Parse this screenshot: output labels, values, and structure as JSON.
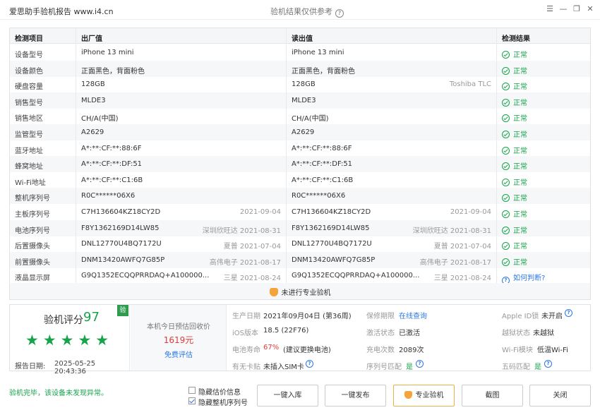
{
  "app_title": "爱思助手验机报告 www.i4.cn",
  "center_title": "验机结果仅供参考",
  "window_icons": [
    "menu-icon",
    "minimize-icon",
    "restore-icon",
    "close-icon"
  ],
  "table": {
    "headers": [
      "检测项目",
      "出厂值",
      "读出值",
      "检测结果"
    ],
    "rows": [
      {
        "name": "设备型号",
        "factory": "iPhone 13 mini",
        "factory_date": "",
        "read": "iPhone 13 mini",
        "read_date": "",
        "result": "正常",
        "status": "ok"
      },
      {
        "name": "设备颜色",
        "factory": "正面黑色，背面粉色",
        "factory_date": "",
        "read": "正面黑色，背面粉色",
        "read_date": "",
        "result": "正常",
        "status": "ok"
      },
      {
        "name": "硬盘容量",
        "factory": "128GB",
        "factory_date": "",
        "read": "128GB",
        "read_date": "Toshiba TLC",
        "result": "正常",
        "status": "ok"
      },
      {
        "name": "销售型号",
        "factory": "MLDE3",
        "factory_date": "",
        "read": "MLDE3",
        "read_date": "",
        "result": "正常",
        "status": "ok"
      },
      {
        "name": "销售地区",
        "factory": "CH/A(中国)",
        "factory_date": "",
        "read": "CH/A(中国)",
        "read_date": "",
        "result": "正常",
        "status": "ok"
      },
      {
        "name": "监管型号",
        "factory": "A2629",
        "factory_date": "",
        "read": "A2629",
        "read_date": "",
        "result": "正常",
        "status": "ok"
      },
      {
        "name": "蓝牙地址",
        "factory": "A*:**:CF:**:88:6F",
        "factory_date": "",
        "read": "A*:**:CF:**:88:6F",
        "read_date": "",
        "result": "正常",
        "status": "ok"
      },
      {
        "name": "蜂窝地址",
        "factory": "A*:**:CF:**:DF:51",
        "factory_date": "",
        "read": "A*:**:CF:**:DF:51",
        "read_date": "",
        "result": "正常",
        "status": "ok"
      },
      {
        "name": "Wi-Fi地址",
        "factory": "A*:**:CF:**:C1:6B",
        "factory_date": "",
        "read": "A*:**:CF:**:C1:6B",
        "read_date": "",
        "result": "正常",
        "status": "ok"
      },
      {
        "name": "整机序列号",
        "factory": "R0C******06X6",
        "factory_date": "",
        "read": "R0C******06X6",
        "read_date": "",
        "result": "正常",
        "status": "ok"
      },
      {
        "name": "主板序列号",
        "factory": "C7H136604KZ18CY2D",
        "factory_date": "2021-09-04",
        "read": "C7H136604KZ18CY2D",
        "read_date": "2021-09-04",
        "result": "正常",
        "status": "ok"
      },
      {
        "name": "电池序列号",
        "factory": "F8Y1362169D14LW85",
        "factory_date": "深圳欣旺达 2021-08-31",
        "read": "F8Y1362169D14LW85",
        "read_date": "深圳欣旺达 2021-08-31",
        "result": "正常",
        "status": "ok"
      },
      {
        "name": "后置摄像头",
        "factory": "DNL12770U4BQ7172U",
        "factory_date": "夏普 2021-07-04",
        "read": "DNL12770U4BQ7172U",
        "read_date": "夏普 2021-07-04",
        "result": "正常",
        "status": "ok"
      },
      {
        "name": "前置摄像头",
        "factory": "DNM13420AWFQ7G85P",
        "factory_date": "高伟电子 2021-08-17",
        "read": "DNM13420AWFQ7G85P",
        "read_date": "高伟电子 2021-08-17",
        "result": "正常",
        "status": "ok"
      },
      {
        "name": "液晶显示屏",
        "factory": "G9Q1352ECQQPRRDAQ+A100000...",
        "factory_date": "三星 2021-08-24",
        "read": "G9Q1352ECQQPRRDAQ+A100000...",
        "read_date": "三星 2021-08-24",
        "result": "如何判断?",
        "status": "question"
      }
    ],
    "footer_note": "未进行专业验机"
  },
  "summary": {
    "score_label": "验机评分",
    "score": "97",
    "badge": "验",
    "stars": "★★★★★",
    "report_date_label": "报告日期:",
    "report_date": "2025-05-25 20:43:36",
    "price_label": "本机今日预估回收价",
    "price": "1619元",
    "price_link": "免费评估",
    "info": [
      {
        "k": "生产日期",
        "v": "2021年09月04日 (第36周)"
      },
      {
        "k": "保修期限",
        "v": "在线查询"
      },
      {
        "k": "Apple ID锁",
        "v": "未开启"
      },
      {
        "k": "iOS版本",
        "v": "18.5 (22F76)"
      },
      {
        "k": "激活状态",
        "v": "已激活"
      },
      {
        "k": "越狱状态",
        "v": "未越狱"
      },
      {
        "k": "电池寿命",
        "v": "67%",
        "v2": "(建议更换电池)"
      },
      {
        "k": "充电次数",
        "v": "2089次"
      },
      {
        "k": "Wi-Fi模块",
        "v": "低温Wi-Fi"
      },
      {
        "k": "有无卡贴",
        "v": "未插入SIM卡"
      },
      {
        "k": "序列号匹配",
        "v": "是"
      },
      {
        "k": "五码匹配",
        "v": "是"
      }
    ]
  },
  "bottom": {
    "status_msg": "验机完毕，该设备未发现异常。",
    "checkbox1": "隐藏估价信息",
    "checkbox1_checked": false,
    "checkbox2": "隐藏整机序列号",
    "checkbox2_checked": true,
    "buttons": [
      "一键入库",
      "一键发布",
      "专业验机",
      "截图",
      "关闭"
    ]
  }
}
